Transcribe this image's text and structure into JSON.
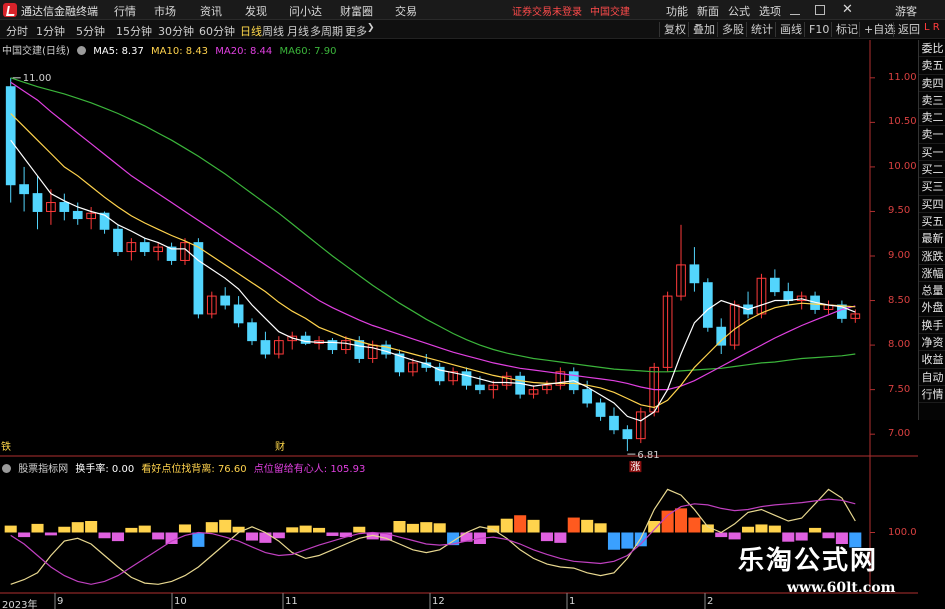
{
  "menubar": {
    "app_title": "通达信金融终端",
    "items": [
      "行情",
      "市场",
      "资讯",
      "发现",
      "问小达",
      "财富圈",
      "交易"
    ],
    "warning": "证券交易未登录",
    "stock_title": "中国交建",
    "right_items": [
      "功能",
      "新面",
      "公式",
      "选项",
      "游客"
    ]
  },
  "toolbar": {
    "periods": [
      "分时",
      "1分钟",
      "5分钟",
      "15分钟",
      "30分钟",
      "60分钟",
      "日线",
      "周线",
      "月线",
      "多周期",
      "更多"
    ],
    "active": "日线",
    "right_buttons": [
      "复权",
      "叠加",
      "多股",
      "统计",
      "画线",
      "F10",
      "标记",
      "+自选",
      "返回"
    ],
    "lr_label": "L R"
  },
  "main_legend": {
    "stock": "中国交建(日线)",
    "ma5": "MA5: 8.37",
    "ma10": "MA10: 8.43",
    "ma20": "MA20: 8.44",
    "ma60": "MA60: 7.90"
  },
  "indicator_legend": {
    "name": "股票指标网",
    "turnover": "换手率: 0.00",
    "sup": "看好点位找背离: 76.60",
    "place": "点位留给有心人: 105.93"
  },
  "side_panel": [
    "委比",
    "卖五",
    "卖四",
    "卖三",
    "卖二",
    "卖一",
    "买一",
    "买二",
    "买三",
    "买四",
    "买五",
    "最新",
    "涨跌",
    "涨幅",
    "总量",
    "外盘",
    "换手",
    "净资",
    "收益",
    "自动",
    "行情"
  ],
  "price_axis": [
    "11.00",
    "10.50",
    "10.00",
    "9.50",
    "9.00",
    "8.50",
    "8.00",
    "7.50",
    "7.00"
  ],
  "indicator_axis": "100.0",
  "date_axis": [
    "2023年",
    "9",
    "10",
    "11",
    "12",
    "1",
    "2"
  ],
  "annotations": {
    "high": "11.00",
    "low": "6.81",
    "low_tag": "涨",
    "marker_a": "铁",
    "marker_b": "财"
  },
  "watermark": {
    "line1": "乐淘公式网",
    "line2": "www.60lt.com"
  },
  "colors": {
    "up": "#ff3b3b",
    "down": "#53d5fd",
    "ma5": "#ffffff",
    "ma10": "#ffd34d",
    "ma20": "#e040e0",
    "ma60": "#3bb53b",
    "axis": "#b03030"
  },
  "chart_data": {
    "type": "candlestick",
    "ylim": [
      6.8,
      11.2
    ],
    "ohlc": [
      [
        10.9,
        11.0,
        9.6,
        9.8
      ],
      [
        9.8,
        10.0,
        9.5,
        9.7
      ],
      [
        9.7,
        9.9,
        9.3,
        9.5
      ],
      [
        9.5,
        9.75,
        9.35,
        9.6
      ],
      [
        9.6,
        9.7,
        9.4,
        9.5
      ],
      [
        9.5,
        9.6,
        9.35,
        9.42
      ],
      [
        9.42,
        9.55,
        9.3,
        9.48
      ],
      [
        9.48,
        9.5,
        9.25,
        9.3
      ],
      [
        9.3,
        9.35,
        9.0,
        9.05
      ],
      [
        9.05,
        9.2,
        8.95,
        9.15
      ],
      [
        9.15,
        9.2,
        9.0,
        9.05
      ],
      [
        9.05,
        9.15,
        8.95,
        9.1
      ],
      [
        9.1,
        9.15,
        8.9,
        8.95
      ],
      [
        8.95,
        9.2,
        8.9,
        9.15
      ],
      [
        9.15,
        9.2,
        8.3,
        8.35
      ],
      [
        8.35,
        8.6,
        8.3,
        8.55
      ],
      [
        8.55,
        8.65,
        8.4,
        8.45
      ],
      [
        8.45,
        8.55,
        8.2,
        8.25
      ],
      [
        8.25,
        8.3,
        8.0,
        8.05
      ],
      [
        8.05,
        8.15,
        7.85,
        7.9
      ],
      [
        7.9,
        8.1,
        7.85,
        8.05
      ],
      [
        8.05,
        8.15,
        7.95,
        8.1
      ],
      [
        8.1,
        8.15,
        8.0,
        8.02
      ],
      [
        8.02,
        8.1,
        7.95,
        8.05
      ],
      [
        8.05,
        8.08,
        7.9,
        7.95
      ],
      [
        7.95,
        8.1,
        7.9,
        8.05
      ],
      [
        8.05,
        8.1,
        7.8,
        7.85
      ],
      [
        7.85,
        8.05,
        7.8,
        8.0
      ],
      [
        8.0,
        8.05,
        7.85,
        7.9
      ],
      [
        7.9,
        7.95,
        7.65,
        7.7
      ],
      [
        7.7,
        7.85,
        7.65,
        7.8
      ],
      [
        7.8,
        7.9,
        7.7,
        7.75
      ],
      [
        7.75,
        7.8,
        7.55,
        7.6
      ],
      [
        7.6,
        7.75,
        7.55,
        7.7
      ],
      [
        7.7,
        7.75,
        7.5,
        7.55
      ],
      [
        7.55,
        7.65,
        7.45,
        7.5
      ],
      [
        7.5,
        7.6,
        7.4,
        7.55
      ],
      [
        7.55,
        7.7,
        7.5,
        7.65
      ],
      [
        7.65,
        7.7,
        7.4,
        7.45
      ],
      [
        7.45,
        7.55,
        7.4,
        7.5
      ],
      [
        7.5,
        7.6,
        7.45,
        7.55
      ],
      [
        7.55,
        7.75,
        7.5,
        7.7
      ],
      [
        7.7,
        7.75,
        7.45,
        7.5
      ],
      [
        7.5,
        7.6,
        7.3,
        7.35
      ],
      [
        7.35,
        7.4,
        7.15,
        7.2
      ],
      [
        7.2,
        7.3,
        7.0,
        7.05
      ],
      [
        7.05,
        7.1,
        6.81,
        6.95
      ],
      [
        6.95,
        7.3,
        6.9,
        7.25
      ],
      [
        7.25,
        7.8,
        7.2,
        7.75
      ],
      [
        7.75,
        8.6,
        7.7,
        8.55
      ],
      [
        8.55,
        9.35,
        8.5,
        8.9
      ],
      [
        8.9,
        9.1,
        8.6,
        8.7
      ],
      [
        8.7,
        8.75,
        8.15,
        8.2
      ],
      [
        8.2,
        8.3,
        7.9,
        8.0
      ],
      [
        8.0,
        8.5,
        7.95,
        8.45
      ],
      [
        8.45,
        8.6,
        8.3,
        8.35
      ],
      [
        8.35,
        8.8,
        8.3,
        8.75
      ],
      [
        8.75,
        8.85,
        8.55,
        8.6
      ],
      [
        8.6,
        8.7,
        8.45,
        8.5
      ],
      [
        8.5,
        8.6,
        8.4,
        8.55
      ],
      [
        8.55,
        8.6,
        8.35,
        8.4
      ],
      [
        8.4,
        8.5,
        8.35,
        8.45
      ],
      [
        8.45,
        8.5,
        8.25,
        8.3
      ],
      [
        8.3,
        8.4,
        8.25,
        8.35
      ]
    ],
    "ma5": [
      10.3,
      10.1,
      9.9,
      9.7,
      9.62,
      9.55,
      9.5,
      9.46,
      9.35,
      9.28,
      9.2,
      9.15,
      9.08,
      9.08,
      8.95,
      8.85,
      8.75,
      8.63,
      8.45,
      8.3,
      8.15,
      8.08,
      8.04,
      8.03,
      8.03,
      8.02,
      7.99,
      7.97,
      7.93,
      7.88,
      7.83,
      7.79,
      7.72,
      7.69,
      7.66,
      7.62,
      7.58,
      7.58,
      7.57,
      7.54,
      7.56,
      7.58,
      7.6,
      7.53,
      7.44,
      7.35,
      7.2,
      7.15,
      7.25,
      7.5,
      7.9,
      8.25,
      8.4,
      8.5,
      8.45,
      8.4,
      8.45,
      8.5,
      8.5,
      8.52,
      8.48,
      8.45,
      8.43,
      8.37
    ],
    "ma10": [
      10.6,
      10.45,
      10.3,
      10.15,
      10.0,
      9.9,
      9.78,
      9.66,
      9.55,
      9.45,
      9.37,
      9.3,
      9.23,
      9.17,
      9.1,
      9.0,
      8.9,
      8.8,
      8.7,
      8.6,
      8.48,
      8.38,
      8.3,
      8.2,
      8.14,
      8.08,
      8.04,
      8.0,
      7.98,
      7.94,
      7.9,
      7.86,
      7.82,
      7.78,
      7.74,
      7.7,
      7.66,
      7.63,
      7.6,
      7.58,
      7.57,
      7.57,
      7.57,
      7.55,
      7.52,
      7.47,
      7.4,
      7.33,
      7.3,
      7.38,
      7.55,
      7.75,
      7.9,
      8.05,
      8.18,
      8.28,
      8.36,
      8.42,
      8.45,
      8.47,
      8.46,
      8.45,
      8.44,
      8.43
    ],
    "ma20": [
      10.95,
      10.85,
      10.75,
      10.62,
      10.5,
      10.38,
      10.26,
      10.14,
      10.02,
      9.9,
      9.8,
      9.7,
      9.6,
      9.5,
      9.4,
      9.3,
      9.2,
      9.1,
      9.0,
      8.9,
      8.8,
      8.7,
      8.6,
      8.5,
      8.42,
      8.35,
      8.28,
      8.22,
      8.17,
      8.12,
      8.07,
      8.02,
      7.97,
      7.92,
      7.88,
      7.84,
      7.8,
      7.77,
      7.74,
      7.72,
      7.7,
      7.68,
      7.66,
      7.64,
      7.62,
      7.6,
      7.57,
      7.53,
      7.5,
      7.5,
      7.54,
      7.6,
      7.68,
      7.76,
      7.84,
      7.92,
      8.0,
      8.08,
      8.15,
      8.22,
      8.28,
      8.34,
      8.4,
      8.44
    ],
    "ma60": [
      11.0,
      10.95,
      10.9,
      10.86,
      10.82,
      10.77,
      10.72,
      10.66,
      10.6,
      10.53,
      10.46,
      10.38,
      10.3,
      10.21,
      10.12,
      10.02,
      9.92,
      9.81,
      9.7,
      9.59,
      9.48,
      9.36,
      9.24,
      9.12,
      9.0,
      8.89,
      8.78,
      8.67,
      8.57,
      8.47,
      8.38,
      8.29,
      8.21,
      8.13,
      8.06,
      8.0,
      7.95,
      7.91,
      7.88,
      7.85,
      7.83,
      7.81,
      7.79,
      7.77,
      7.75,
      7.73,
      7.72,
      7.71,
      7.7,
      7.7,
      7.71,
      7.72,
      7.73,
      7.74,
      7.76,
      7.78,
      7.8,
      7.81,
      7.83,
      7.85,
      7.86,
      7.87,
      7.88,
      7.9
    ],
    "indicator": {
      "ylim": [
        0,
        200
      ],
      "bars": [
        12,
        -8,
        15,
        -5,
        10,
        18,
        20,
        -10,
        -15,
        8,
        12,
        -12,
        -20,
        14,
        -25,
        18,
        22,
        10,
        -14,
        -18,
        -10,
        9,
        12,
        8,
        -6,
        -8,
        10,
        -12,
        -14,
        20,
        15,
        18,
        16,
        -22,
        -16,
        -20,
        12,
        24,
        30,
        22,
        -15,
        -18,
        26,
        22,
        16,
        -30,
        -28,
        -24,
        20,
        38,
        42,
        26,
        14,
        -8,
        -12,
        10,
        14,
        12,
        -16,
        -14,
        8,
        -10,
        -20,
        -26
      ],
      "line_yellow": [
        10,
        18,
        30,
        60,
        85,
        90,
        80,
        60,
        40,
        22,
        12,
        10,
        15,
        25,
        40,
        60,
        80,
        100,
        110,
        100,
        85,
        65,
        55,
        60,
        70,
        80,
        90,
        95,
        90,
        80,
        70,
        65,
        70,
        85,
        100,
        110,
        105,
        90,
        70,
        55,
        45,
        40,
        38,
        30,
        25,
        30,
        55,
        90,
        140,
        175,
        165,
        140,
        110,
        100,
        115,
        135,
        140,
        130,
        120,
        125,
        150,
        175,
        160,
        120
      ],
      "line_purple": [
        95,
        80,
        60,
        40,
        25,
        15,
        10,
        15,
        25,
        40,
        55,
        70,
        85,
        95,
        100,
        98,
        92,
        85,
        75,
        65,
        60,
        62,
        70,
        78,
        85,
        92,
        98,
        100,
        98,
        92,
        86,
        80,
        78,
        80,
        85,
        90,
        92,
        88,
        80,
        70,
        62,
        55,
        50,
        48,
        46,
        50,
        60,
        80,
        105,
        130,
        145,
        150,
        148,
        142,
        138,
        140,
        145,
        148,
        150,
        152,
        155,
        158,
        156,
        150
      ]
    }
  }
}
